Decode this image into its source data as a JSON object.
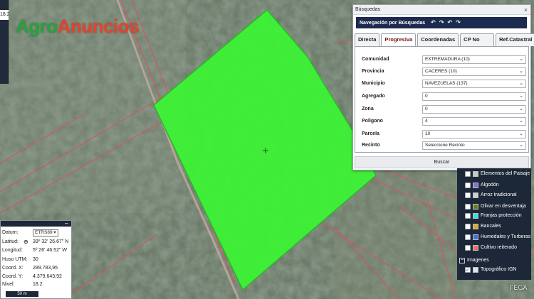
{
  "logo": {
    "part1": "Agro",
    "part2": "Anuncios"
  },
  "topleft": {
    "value": "18.2"
  },
  "search_panel": {
    "title": "Búsquedas",
    "close_glyph": "×",
    "nav_title": "Navegación por Búsquedas",
    "nav_icons": [
      "↶",
      "↷",
      "↶",
      "↷"
    ],
    "tabs": [
      {
        "label": "Directa",
        "active": false
      },
      {
        "label": "Progresiva",
        "active": true
      },
      {
        "label": "Coordenadas",
        "active": false
      },
      {
        "label": "CP No Integradas",
        "active": false
      },
      {
        "label": "Ref.Catastral",
        "active": false
      }
    ],
    "fields": [
      {
        "label": "Comunidad",
        "value": "EXTREMADURA (10)"
      },
      {
        "label": "Provincia",
        "value": "CACERES (10)"
      },
      {
        "label": "Municipio",
        "value": "NAVEZUELAS (137)"
      },
      {
        "label": "Agregado",
        "value": "0"
      },
      {
        "label": "Zona",
        "value": "0"
      },
      {
        "label": "Poligono",
        "value": "4"
      },
      {
        "label": "Parcela",
        "value": "10"
      },
      {
        "label": "Recinto",
        "value": "Seleccione Recinto"
      }
    ],
    "search_button": "Buscar"
  },
  "layers": {
    "items": [
      {
        "label": "Elementos del Paisaje",
        "color": "#c8c8c8",
        "checked": false
      },
      {
        "label": "Algodón",
        "color": "#8a6bd8",
        "checked": false
      },
      {
        "label": "Arroz tradicional",
        "color": "#cfd0d2",
        "checked": false
      },
      {
        "label": "Olivar en desventaja",
        "color": "#727a1a",
        "checked": false
      },
      {
        "label": "Franjas protección",
        "color": "#37e0e8",
        "checked": false
      },
      {
        "label": "Bancales",
        "color": "#e0a426",
        "checked": false
      },
      {
        "label": "Humedales y Turberas",
        "color": "#4a6ed0",
        "checked": false
      },
      {
        "label": "Cultivo reiterado",
        "color": "#ef6b5c",
        "checked": false
      }
    ],
    "group_label": "Imagenes",
    "group_items": [
      {
        "label": "Topográfico IGN",
        "checked": true
      }
    ]
  },
  "map": {
    "provider_label": "FEGA"
  },
  "coords": {
    "datum_label": "Datum:",
    "datum_value": "ETRS89",
    "rows": [
      {
        "label": "Latitud:",
        "value": "39º 32' 26.67\" N"
      },
      {
        "label": "Longitud:",
        "value": "5º 26' 46.52\" W"
      },
      {
        "label": "Huso UTM:",
        "value": "30"
      },
      {
        "label": "Coord. X:",
        "value": "289.783,95"
      },
      {
        "label": "Coord. Y:",
        "value": "4.379.643,92"
      },
      {
        "label": "Nivel:",
        "value": "18.2"
      }
    ],
    "scale": "50 m"
  }
}
